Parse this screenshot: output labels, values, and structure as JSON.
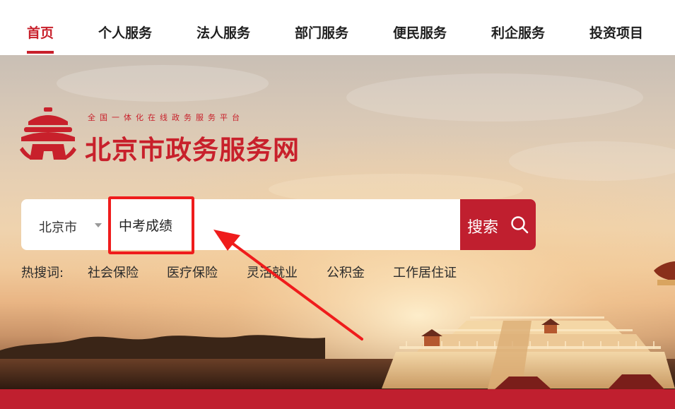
{
  "nav": {
    "items": [
      {
        "label": "首页",
        "active": true
      },
      {
        "label": "个人服务",
        "active": false
      },
      {
        "label": "法人服务",
        "active": false
      },
      {
        "label": "部门服务",
        "active": false
      },
      {
        "label": "便民服务",
        "active": false
      },
      {
        "label": "利企服务",
        "active": false
      },
      {
        "label": "投资项目",
        "active": false
      }
    ]
  },
  "logo": {
    "slogan": "全国一体化在线政务服务平台",
    "title": "北京市政务服务网"
  },
  "search": {
    "city": "北京市",
    "query": "中考成绩",
    "button_label": "搜索"
  },
  "hot_searches": {
    "label": "热搜词:",
    "items": [
      "社会保险",
      "医疗保险",
      "灵活就业",
      "公积金",
      "工作居住证"
    ]
  },
  "colors": {
    "brand_red": "#c8202b",
    "button_red": "#c01f2f",
    "annotation_red": "#ef1c1c"
  },
  "icons": {
    "search": "search-icon",
    "emblem": "temple-emblem-icon",
    "city_dropdown": "caret-down-icon"
  }
}
